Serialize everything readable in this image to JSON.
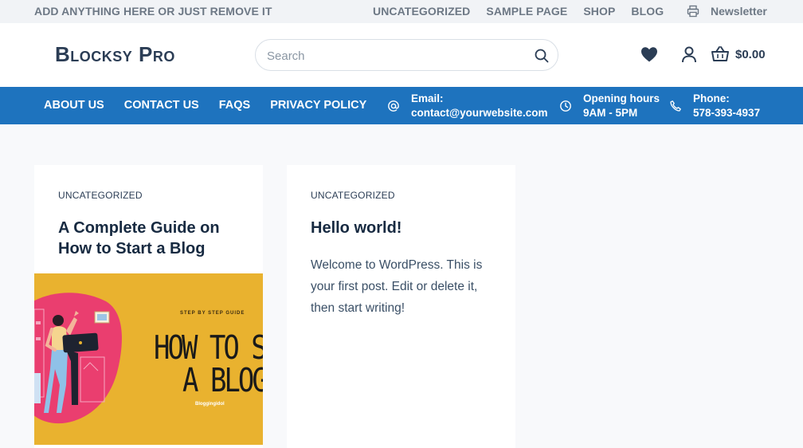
{
  "topbar": {
    "tagline": "ADD ANYTHING HERE OR JUST REMOVE IT",
    "nav": [
      "UNCATEGORIZED",
      "SAMPLE PAGE",
      "SHOP",
      "BLOG"
    ],
    "newsletter_label": "Newsletter",
    "newsletter_icon": "printer-icon"
  },
  "header": {
    "logo": "Blocksy Pro",
    "search_placeholder": "Search",
    "cart_total": "$0.00"
  },
  "mainnav": {
    "menu": [
      "ABOUT US",
      "CONTACT US",
      "FAQS",
      "PRIVACY POLICY"
    ],
    "contacts": [
      {
        "icon": "at-icon",
        "label": "Email:",
        "value": "contact@yourwebsite.com"
      },
      {
        "icon": "clock-icon",
        "label": "Opening hours",
        "value": "9AM - 5PM"
      },
      {
        "icon": "phone-icon",
        "label": "Phone:",
        "value": "578-393-4937"
      }
    ]
  },
  "posts": [
    {
      "category": "UNCATEGORIZED",
      "title": "A Complete Guide on How to Start a Blog",
      "image": {
        "kicker": "STEP BY STEP GUIDE",
        "line1": "HOW TO STAR",
        "line2": "A BLOG",
        "credit": "Bloggingidol"
      }
    },
    {
      "category": "UNCATEGORIZED",
      "title": "Hello world!",
      "excerpt": "Welcome to WordPress. This is your first post. Edit or delete it, then start writing!"
    }
  ],
  "colors": {
    "accent": "#1e73be",
    "topbar_bg": "#f1f3f6",
    "page_bg": "#f8f9fb",
    "thumb_bg": "#e9b22f",
    "thumb_blob": "#ea3e6f"
  }
}
